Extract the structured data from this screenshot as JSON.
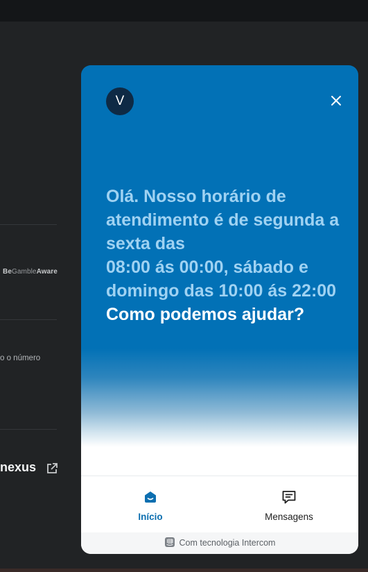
{
  "background_page": {
    "begambleaware": {
      "be": "Be",
      "gamble": "Gamble",
      "aware": "Aware"
    },
    "number_text": "o o número",
    "nexus_text": "nexus"
  },
  "messenger": {
    "avatar_letter": "V",
    "greeting_text": "Olá. Nosso horário de atendimento é de segunda a sexta das\n 08:00 ás 00:00, sábado e domingo das 10:00 ás 22:00",
    "prompt_text": "Como podemos ajudar?",
    "nav": {
      "home_label": "Início",
      "messages_label": "Mensagens"
    },
    "footer_text": "Com tecnologia Intercom",
    "colors": {
      "brand": "#0271b6",
      "greeting": "#9fd2f2",
      "active_tab": "#0d6fb0"
    }
  }
}
